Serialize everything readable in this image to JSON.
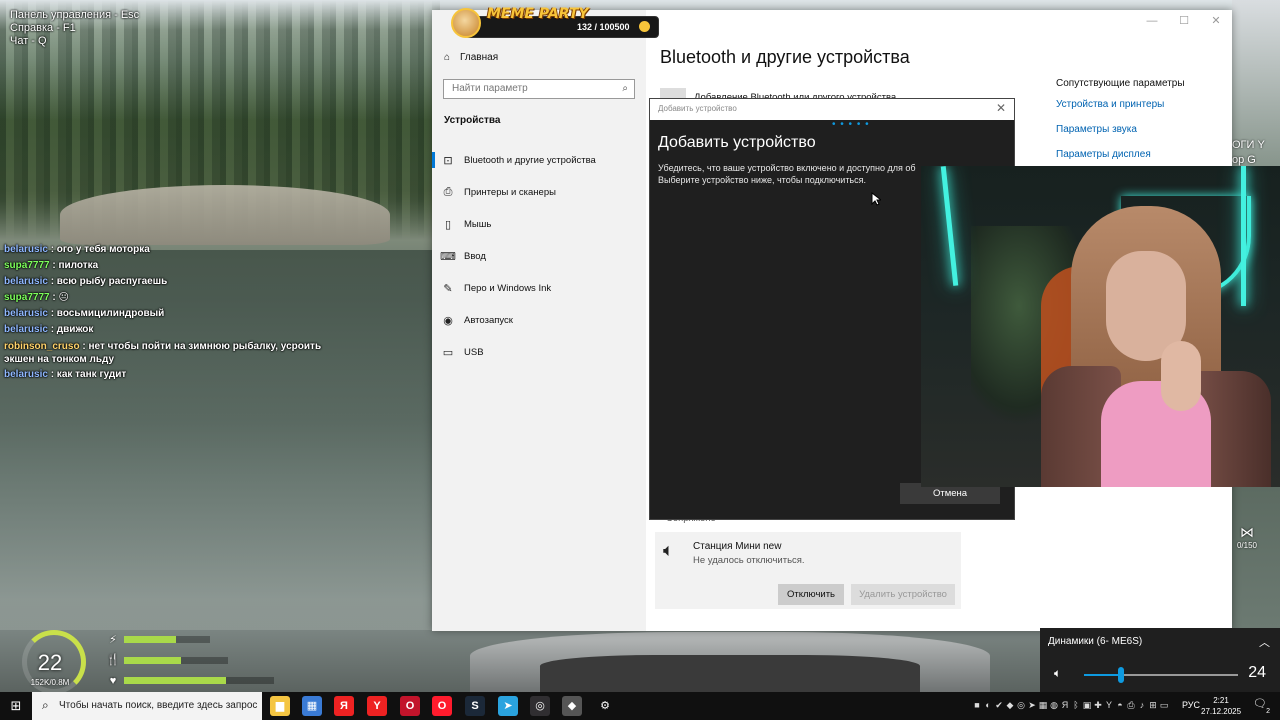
{
  "game": {
    "help_lines": [
      "Панель управления - Esc",
      "Справка - F1",
      "Чат - Q"
    ],
    "level": "22",
    "xp": "152K/0.8M",
    "bars": [
      {
        "icon": "⚡",
        "value": 0.6
      },
      {
        "icon": "🍴",
        "value": 0.55
      },
      {
        "icon": "♥",
        "value": 0.68
      }
    ],
    "fish_counter": "0/150",
    "right_edge_text": [
      "ОГИ Y",
      "op G"
    ]
  },
  "chat": {
    "messages": [
      {
        "user": "belarusic",
        "color": "#8fb8ff",
        "text": ": ого у тебя моторка"
      },
      {
        "user": "supa7777",
        "color": "#7dff5c",
        "text": ": пилотка"
      },
      {
        "user": "belarusic",
        "color": "#8fb8ff",
        "text": ": всю рыбу распугаешь"
      },
      {
        "user": "supa7777",
        "color": "#7dff5c",
        "text": ": 😐"
      },
      {
        "user": "belarusic",
        "color": "#8fb8ff",
        "text": ": восьмицилиндровый"
      },
      {
        "user": "belarusic",
        "color": "#8fb8ff",
        "text": ": движок"
      },
      {
        "user": "robinson_cruso",
        "color": "#ffd36b",
        "text": ": нет чтобы пойти на зимнюю рыбалку, усроить экшен на тонком льду"
      },
      {
        "user": "belarusic",
        "color": "#8fb8ff",
        "text": ": как танк гудит"
      }
    ]
  },
  "meme_party": {
    "logo": "MEME PARTY",
    "count": "132 / 100500"
  },
  "settings": {
    "window_controls": [
      "—",
      "☐",
      "✕"
    ],
    "home_label": "Главная",
    "search_placeholder": "Найти параметр",
    "section_label": "Устройства",
    "nav_items": [
      {
        "icon": "bluetooth-icon",
        "glyph": "⊡",
        "label": "Bluetooth и другие устройства",
        "active": true
      },
      {
        "icon": "printer-icon",
        "glyph": "⎙",
        "label": "Принтеры и сканеры",
        "active": false
      },
      {
        "icon": "mouse-icon",
        "glyph": "▯",
        "label": "Мышь",
        "active": false
      },
      {
        "icon": "keyboard-icon",
        "glyph": "⌨",
        "label": "Ввод",
        "active": false
      },
      {
        "icon": "pen-icon",
        "glyph": "✎",
        "label": "Перо и Windows Ink",
        "active": false
      },
      {
        "icon": "autoplay-icon",
        "glyph": "◉",
        "label": "Автозапуск",
        "active": false
      },
      {
        "icon": "usb-icon",
        "glyph": "▭",
        "label": "USB",
        "active": false
      }
    ],
    "page_title": "Bluetooth и другие устройства",
    "add_device_label": "Добавление Bluetooth или другого устройства",
    "related_header": "Сопутствующие параметры",
    "related_links": [
      "Устройства и принтеры",
      "Параметры звука",
      "Параметры дисплея"
    ],
    "paired_label": "Сопряжено",
    "device": {
      "name": "Станция Мини new",
      "status": "Не удалось отключиться.",
      "disconnect_label": "Отключить",
      "remove_label": "Удалить устройство"
    }
  },
  "dialog": {
    "window_title": "Добавить устройство",
    "heading": "Добавить устройство",
    "line1": "Убедитесь, что ваше устройство включено и доступно для об",
    "line2": "Выберите устройство ниже, чтобы подключиться.",
    "cancel_label": "Отмена",
    "progress_dots": "• • • • •"
  },
  "volume": {
    "device_label": "Динамики (6- ME6S)",
    "level": 24,
    "level_text": "24"
  },
  "taskbar": {
    "search_placeholder": "Чтобы начать поиск, введите здесь запрос",
    "apps": [
      {
        "name": "file-explorer-icon",
        "glyph": "▆",
        "color": "#f4c542"
      },
      {
        "name": "store-icon",
        "glyph": "▦",
        "color": "#3a7bd5"
      },
      {
        "name": "yandex-icon",
        "glyph": "Я",
        "color": "#e22"
      },
      {
        "name": "yandex-browser-icon",
        "glyph": "Y",
        "color": "#e22"
      },
      {
        "name": "opera-gx-icon",
        "glyph": "O",
        "color": "#c2142b"
      },
      {
        "name": "opera-icon",
        "glyph": "O",
        "color": "#ff1b2d"
      },
      {
        "name": "steam-icon",
        "glyph": "S",
        "color": "#1b2838"
      },
      {
        "name": "telegram-icon",
        "glyph": "➤",
        "color": "#2aa3df"
      },
      {
        "name": "obs-icon",
        "glyph": "◎",
        "color": "#302e31"
      },
      {
        "name": "game-icon",
        "glyph": "◆",
        "color": "#555"
      },
      {
        "name": "settings-icon",
        "glyph": "⚙",
        "color": "#101010"
      }
    ],
    "language": "РУС",
    "time": "2:21",
    "date": "27.12.2025",
    "notification_count": "2"
  }
}
